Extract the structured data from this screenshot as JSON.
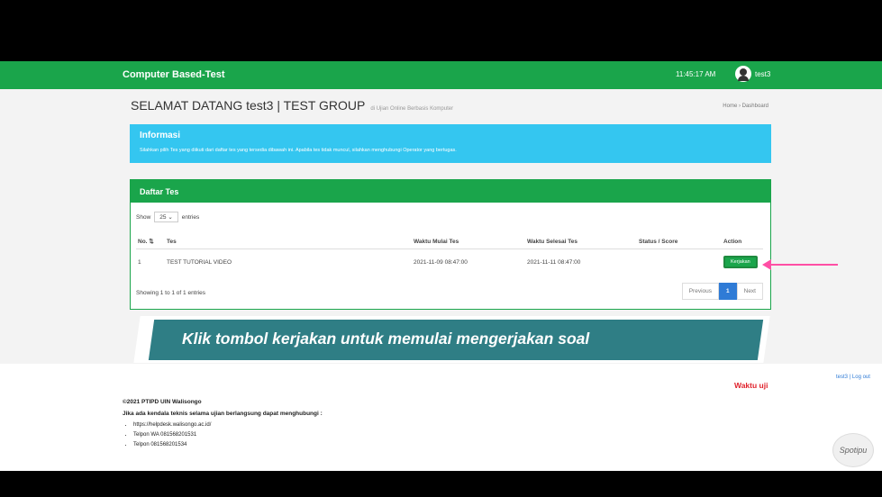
{
  "header": {
    "brand": "Computer Based-Test",
    "clock": "11:45:17 AM",
    "user": "test3"
  },
  "welcome": {
    "title": "SELAMAT DATANG test3 | TEST GROUP",
    "subtitle": "di Ujian Online Berbasis Komputer"
  },
  "breadcrumb": "Home › Dashboard",
  "info": {
    "title": "Informasi",
    "text": "Silahkan pilih Tes yang diikuti dari daftar tes yang tersedia dibawah ini. Apabila tes tidak muncul, silahkan menghubungi Operator yang bertugas."
  },
  "list": {
    "title": "Daftar Tes",
    "show_label": "Show",
    "entries_value": "25",
    "entries_label": "entries",
    "columns": [
      "No. ⇅",
      "Tes",
      "Waktu Mulai Tes",
      "Waktu Selesai Tes",
      "Status / Score",
      "Action"
    ],
    "rows": [
      {
        "no": "1",
        "tes": "TEST TUTORIAL VIDEO",
        "mulai": "2021-11-09 08:47:00",
        "selesai": "2021-11-11 08:47:00",
        "status": "",
        "action": "Kerjakan"
      }
    ],
    "showing": "Showing 1 to 1 of 1 entries",
    "pager": {
      "prev": "Previous",
      "current": "1",
      "next": "Next"
    }
  },
  "overlay_caption": "Klik tombol kerjakan untuk memulai mengerjakan soal",
  "timer_label": "Waktu uji",
  "user_links": "test3 | Log out",
  "footer": {
    "copyright": "©2021 PTIPD UIN Walisongo",
    "contact": "Jika ada kendala teknis selama ujian berlangsung dapat menghubungi :",
    "links": [
      "https://helpdesk.walisongo.ac.id/",
      "Telpon WA 081568201531",
      "Telpon 081568201534"
    ]
  },
  "watermark": "Spotipu"
}
